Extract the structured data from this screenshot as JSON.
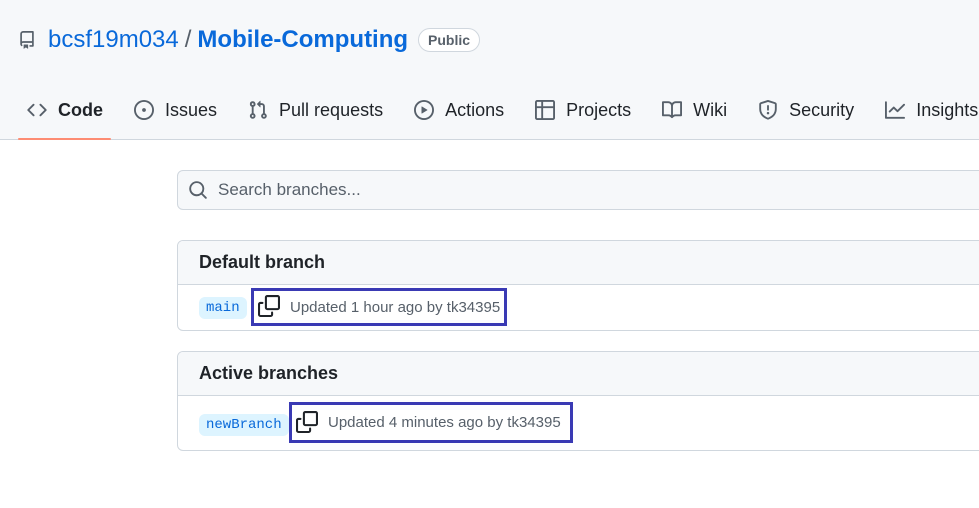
{
  "repo": {
    "owner": "bcsf19m034",
    "separator": "/",
    "name": "Mobile-Computing",
    "visibility": "Public"
  },
  "tabs": [
    {
      "label": "Code",
      "icon": "code-icon",
      "active": true
    },
    {
      "label": "Issues",
      "icon": "issue-icon"
    },
    {
      "label": "Pull requests",
      "icon": "pull-request-icon"
    },
    {
      "label": "Actions",
      "icon": "play-icon"
    },
    {
      "label": "Projects",
      "icon": "table-icon"
    },
    {
      "label": "Wiki",
      "icon": "book-icon"
    },
    {
      "label": "Security",
      "icon": "shield-icon"
    },
    {
      "label": "Insights",
      "icon": "graph-icon"
    }
  ],
  "search": {
    "placeholder": "Search branches..."
  },
  "default_branch": {
    "title": "Default branch",
    "branch": "main",
    "updated": "Updated 1 hour ago by tk34395"
  },
  "active_branches": {
    "title": "Active branches",
    "branch": "newBranch",
    "updated": "Updated 4 minutes ago by tk34395"
  },
  "colors": {
    "link": "#0969da",
    "underline": "#fd8c73",
    "highlight_box": "#3a3ab4"
  }
}
